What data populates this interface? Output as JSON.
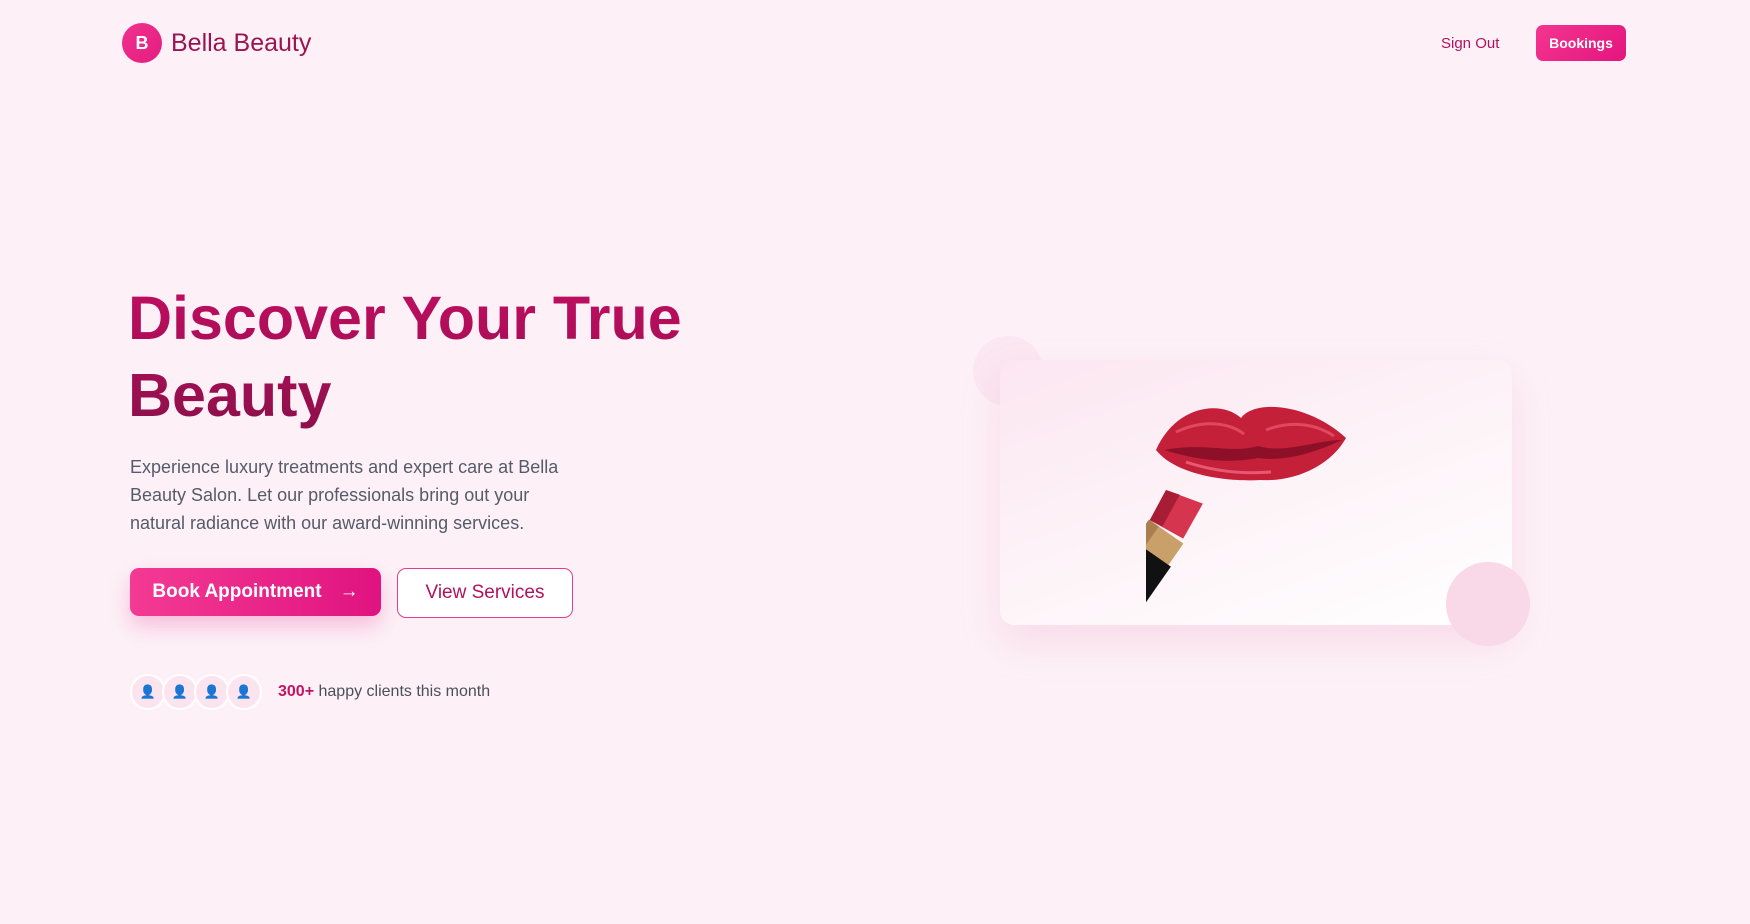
{
  "nav": {
    "brand_initial": "B",
    "brand_name": "Bella Beauty",
    "sign_out": "Sign Out",
    "bookings": "Bookings"
  },
  "hero": {
    "title": "Discover Your True Beauty",
    "description": "Experience luxury treatments and expert care at Bella Beauty Salon. Let our professionals bring out your natural radiance with our award-winning services.",
    "primary_button": "Book Appointment",
    "primary_button_arrow": "→",
    "secondary_button": "View Services",
    "clients_count": "300+",
    "clients_text": "happy clients this month",
    "avatar_icon": "👤",
    "illustration": "lips-and-lipstick-icon"
  },
  "colors": {
    "background": "#fdf1f7",
    "accent": "#e61e84",
    "title_dark": "#8b0f4a",
    "text_muted": "#555b6a"
  }
}
